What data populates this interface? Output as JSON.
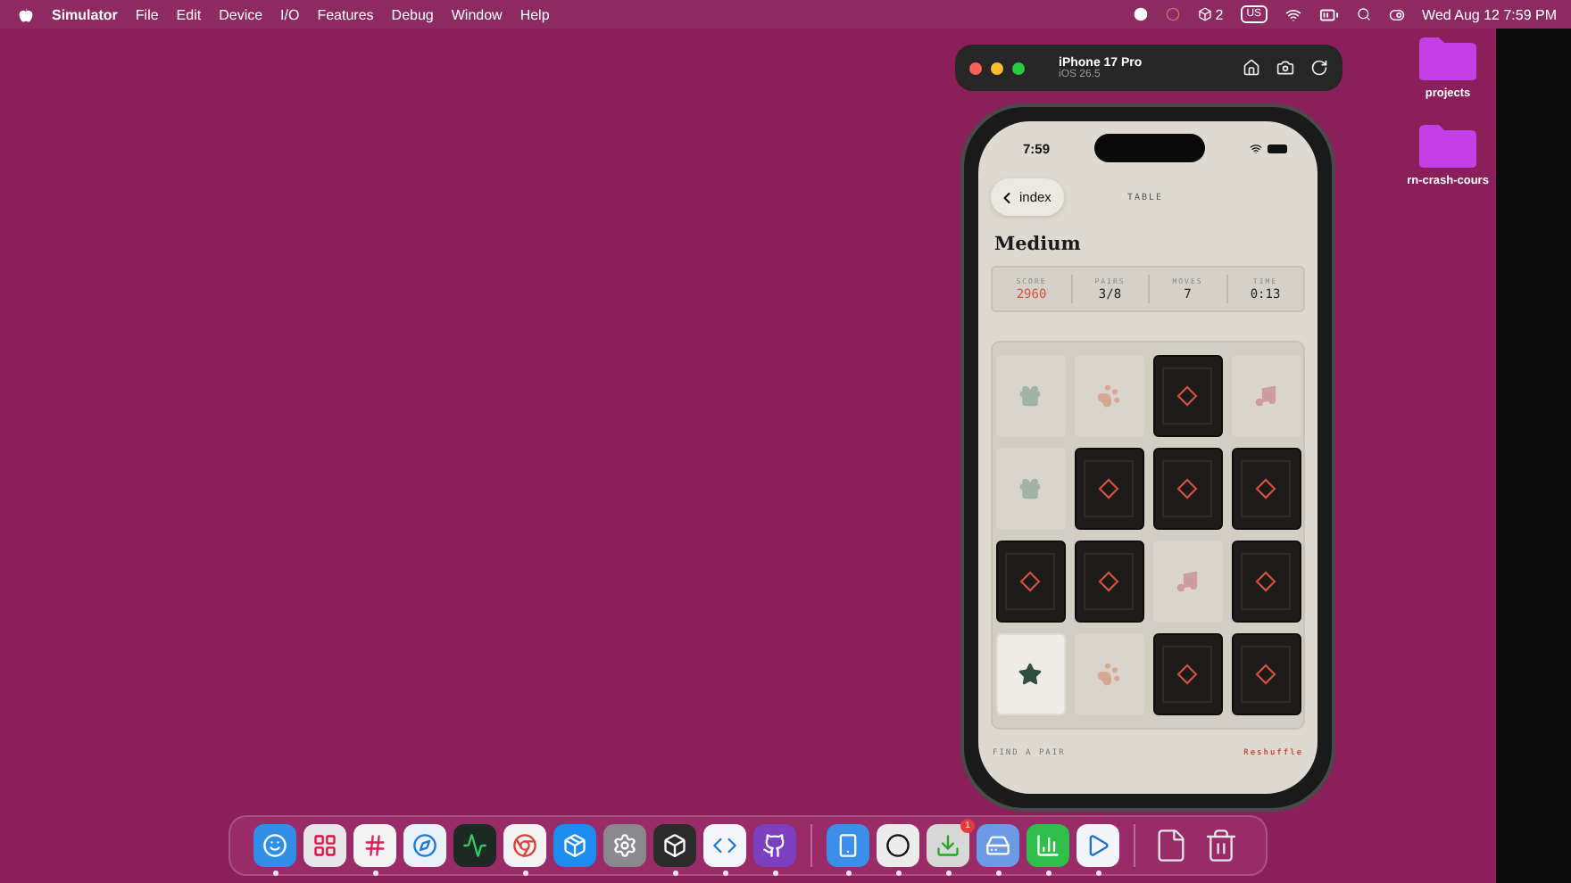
{
  "menu_bar": {
    "app_name": "Simulator",
    "menus": [
      "File",
      "Edit",
      "Device",
      "I/O",
      "Features",
      "Debug",
      "Window",
      "Help"
    ],
    "badge_count": "2",
    "input_source": "US",
    "clock": "Wed Aug 12  7:59 PM"
  },
  "desktop_folders": [
    {
      "label": "projects"
    },
    {
      "label": "rn-crash-cours"
    }
  ],
  "simulator": {
    "device": "iPhone 17 Pro",
    "os": "iOS 26.5"
  },
  "phone": {
    "time": "7:59",
    "back_label": "index",
    "title": "TABLE",
    "heading": "Medium",
    "stats": [
      {
        "label": "SCORE",
        "value": "2960",
        "highlight": true
      },
      {
        "label": "PAIRS",
        "value": "3/8",
        "highlight": false
      },
      {
        "label": "MOVES",
        "value": "7",
        "highlight": false
      },
      {
        "label": "TIME",
        "value": "0:13",
        "highlight": false
      }
    ],
    "cards": [
      {
        "kind": "gift",
        "matched": true
      },
      {
        "kind": "paw",
        "matched": true
      },
      {
        "kind": "hidden"
      },
      {
        "kind": "note",
        "matched": true
      },
      {
        "kind": "gift",
        "matched": true
      },
      {
        "kind": "hidden"
      },
      {
        "kind": "hidden"
      },
      {
        "kind": "hidden"
      },
      {
        "kind": "hidden"
      },
      {
        "kind": "hidden"
      },
      {
        "kind": "note",
        "matched": true
      },
      {
        "kind": "hidden"
      },
      {
        "kind": "star",
        "matched": false
      },
      {
        "kind": "paw",
        "matched": true
      },
      {
        "kind": "hidden"
      },
      {
        "kind": "hidden"
      }
    ],
    "footer_hint": "FIND A PAIR",
    "reshuffle": "Reshuffle"
  },
  "dock": [
    {
      "kind": "finder",
      "running": true
    },
    {
      "kind": "launchpad",
      "running": false
    },
    {
      "kind": "slack",
      "running": true
    },
    {
      "kind": "safari",
      "running": false
    },
    {
      "kind": "activity",
      "running": false
    },
    {
      "kind": "chrome",
      "running": true
    },
    {
      "kind": "appstore",
      "running": false
    },
    {
      "kind": "settings",
      "running": false
    },
    {
      "kind": "cube",
      "running": true
    },
    {
      "kind": "vscode",
      "running": true
    },
    {
      "kind": "github",
      "running": true
    },
    {
      "kind": "divider"
    },
    {
      "kind": "simulator",
      "running": true
    },
    {
      "kind": "upwork",
      "running": true
    },
    {
      "kind": "installer",
      "running": true,
      "badge": "1"
    },
    {
      "kind": "disk",
      "running": true
    },
    {
      "kind": "numbers",
      "running": true
    },
    {
      "kind": "quicktime",
      "running": true
    },
    {
      "kind": "divider"
    },
    {
      "kind": "document",
      "running": false
    },
    {
      "kind": "trash",
      "running": false
    }
  ]
}
